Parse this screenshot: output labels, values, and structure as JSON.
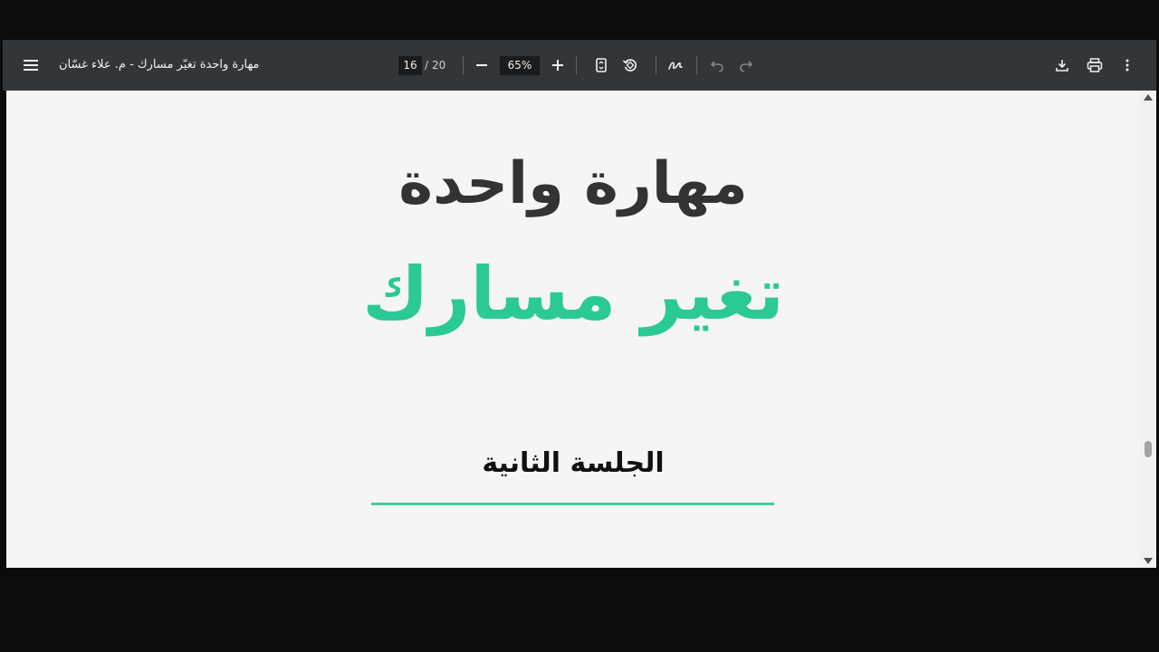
{
  "viewer": {
    "title": "مهارة واحدة تغيّر مسارك - م. علاء غسّان",
    "page": {
      "current": "16",
      "separator": "/",
      "total": "20"
    },
    "zoom": "65%"
  },
  "icons": {
    "menu": "hamburger-menu-icon",
    "zoom_out": "minus-icon",
    "zoom_in": "plus-icon",
    "fit_page": "fit-to-page-icon",
    "rotate": "rotate-icon",
    "annotate": "pen-annotate-icon",
    "undo": "undo-icon",
    "redo": "redo-icon",
    "download": "download-icon",
    "print": "print-icon",
    "more": "more-vertical-icon"
  },
  "document": {
    "line1": "مهارة واحدة",
    "line2": "تغير مسارك",
    "subtitle": "الجلسة الثانية"
  },
  "colors": {
    "toolbar": "#323639",
    "accent_green": "#2bc996",
    "heading_dark": "#333333"
  }
}
